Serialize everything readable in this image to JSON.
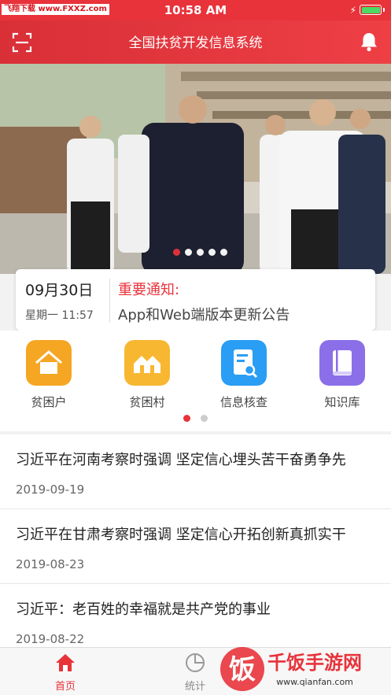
{
  "status_bar": {
    "time": "10:58 AM",
    "watermark": "飞翔下载 www.FXXZ.com",
    "battery_level": 1.0
  },
  "header": {
    "title": "全国扶贫开发信息系统",
    "scan_icon": "scan-icon",
    "bell_icon": "bell-icon"
  },
  "banner": {
    "slide_count": 5,
    "active_slide": 0
  },
  "notice": {
    "date": "09月30日",
    "weekday_time": "星期一 11:57",
    "label": "重要通知:",
    "text": "App和Web端版本更新公告"
  },
  "quick_menu": {
    "items": [
      {
        "label": "贫困户",
        "icon": "house-icon",
        "color": "#f5a623"
      },
      {
        "label": "贫困村",
        "icon": "village-icon",
        "color": "#f7b731"
      },
      {
        "label": "信息核查",
        "icon": "document-search-icon",
        "color": "#2a9df4"
      },
      {
        "label": "知识库",
        "icon": "book-icon",
        "color": "#8a6fe8"
      }
    ],
    "page_count": 2,
    "active_page": 0
  },
  "news": [
    {
      "title": "习近平在河南考察时强调 坚定信心埋头苦干奋勇争先",
      "date": "2019-09-19"
    },
    {
      "title": "习近平在甘肃考察时强调 坚定信心开拓创新真抓实干",
      "date": "2019-08-23"
    },
    {
      "title": "习近平：老百姓的幸福就是共产党的事业",
      "date": "2019-08-22"
    }
  ],
  "tabs": [
    {
      "label": "首页",
      "icon": "home-icon",
      "active": true
    },
    {
      "label": "统计",
      "icon": "pie-chart-icon",
      "active": false
    }
  ],
  "watermark_bottom": {
    "brand": "饭",
    "text": "千饭手游网",
    "url": "www.qianfan.com"
  },
  "colors": {
    "accent": "#e8333b",
    "tab_inactive": "#888888"
  }
}
